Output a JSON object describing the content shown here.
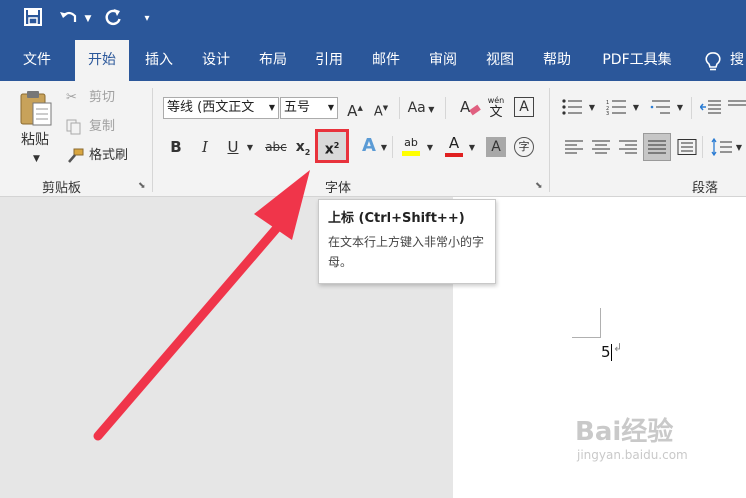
{
  "quick_access": {
    "save_icon": "save-icon",
    "undo_icon": "undo-icon",
    "redo_icon": "repeat-icon",
    "customize_icon": "customize-icon"
  },
  "tabs": [
    {
      "label": "文件"
    },
    {
      "label": "开始"
    },
    {
      "label": "插入"
    },
    {
      "label": "设计"
    },
    {
      "label": "布局"
    },
    {
      "label": "引用"
    },
    {
      "label": "邮件"
    },
    {
      "label": "审阅"
    },
    {
      "label": "视图"
    },
    {
      "label": "帮助"
    },
    {
      "label": "PDF工具集"
    },
    {
      "label": "搜"
    }
  ],
  "clipboard": {
    "paste": "粘贴",
    "cut": "剪切",
    "copy": "复制",
    "format_painter": "格式刷",
    "group_label": "剪贴板"
  },
  "font": {
    "font_name": "等线 (西文正文",
    "font_size": "五号",
    "grow": "A",
    "shrink": "A",
    "case": "Aa",
    "phonetic_top": "wén",
    "phonetic_bottom": "文",
    "border_char": "A",
    "bold": "B",
    "italic": "I",
    "underline": "U",
    "strike": "abc",
    "subscript_base": "x",
    "subscript_mark": "2",
    "superscript_base": "x",
    "superscript_mark": "2",
    "effects": "A",
    "highlight": "ab",
    "color": "A",
    "shade": "A",
    "enclose": "字",
    "group_label": "字体"
  },
  "paragraph": {
    "group_label": "段落"
  },
  "tooltip": {
    "title": "上标 (Ctrl+Shift++)",
    "description": "在文本行上方键入非常小的字母。"
  },
  "document": {
    "text": "5"
  },
  "watermark": {
    "brand": "Bai经验",
    "url": "jingyan.baidu.com"
  },
  "colors": {
    "ribbon_blue": "#2b579a",
    "annotation_red": "#e8323c",
    "font_color_bar": "#e02020",
    "highlight_bar": "#ffff00"
  }
}
